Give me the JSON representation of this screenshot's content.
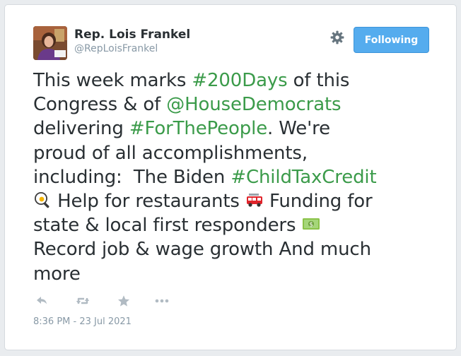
{
  "author": {
    "name": "Rep. Lois Frankel",
    "handle": "@RepLoisFrankel"
  },
  "follow_button": {
    "label": "Following"
  },
  "tweet": {
    "lines": [
      [
        {
          "t": "This week marks "
        },
        {
          "t": "#200Days",
          "link": true
        },
        {
          "t": " of this"
        }
      ],
      [
        {
          "t": "Congress & of "
        },
        {
          "t": "@HouseDemocrats",
          "link": true
        }
      ],
      [
        {
          "t": "delivering "
        },
        {
          "t": "#ForThePeople",
          "link": true
        },
        {
          "t": ". We're"
        }
      ],
      [
        {
          "t": "proud of all accomplishments,"
        }
      ],
      [
        {
          "t": "including:  The Biden "
        },
        {
          "t": "#ChildTaxCredit",
          "link": true
        }
      ],
      [
        {
          "emoji": "cooking"
        },
        {
          "t": " Help for restaurants "
        },
        {
          "emoji": "fire-engine"
        },
        {
          "t": " Funding for"
        }
      ],
      [
        {
          "t": "state & local first responders "
        },
        {
          "emoji": "money"
        }
      ],
      [
        {
          "t": "Record job & wage growth And much"
        }
      ],
      [
        {
          "t": "more"
        }
      ]
    ]
  },
  "timestamp": "8:36 PM - 23 Jul 2021",
  "icons": {
    "gear": "gear-icon",
    "reply": "reply-icon",
    "retweet": "retweet-icon",
    "favorite": "star-icon",
    "more": "more-icon"
  },
  "colors": {
    "link": "#3b9b4a",
    "button": "#55acee",
    "text": "#292f33",
    "muted": "#8899a6"
  }
}
